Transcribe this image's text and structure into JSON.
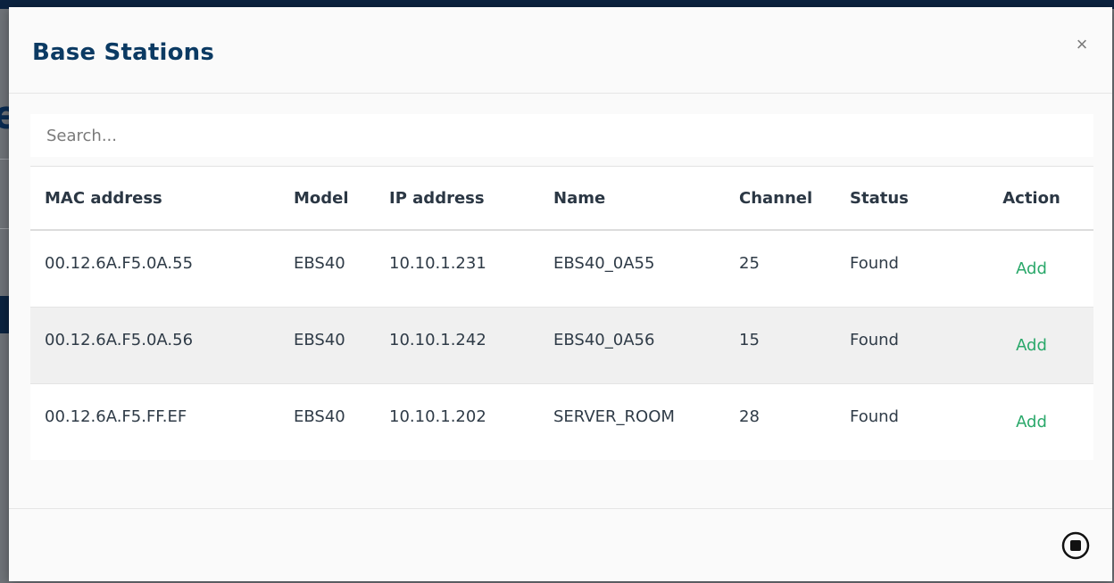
{
  "modal": {
    "title": "Base Stations",
    "close_label": "×"
  },
  "search": {
    "placeholder": "Search..."
  },
  "table": {
    "headers": [
      "MAC address",
      "Model",
      "IP address",
      "Name",
      "Channel",
      "Status",
      "Action"
    ],
    "rows": [
      {
        "mac": "00.12.6A.F5.0A.55",
        "model": "EBS40",
        "ip": "10.10.1.231",
        "name": "EBS40_0A55",
        "channel": "25",
        "status": "Found",
        "action": "Add"
      },
      {
        "mac": "00.12.6A.F5.0A.56",
        "model": "EBS40",
        "ip": "10.10.1.242",
        "name": "EBS40_0A56",
        "channel": "15",
        "status": "Found",
        "action": "Add"
      },
      {
        "mac": "00.12.6A.F5.FF.EF",
        "model": "EBS40",
        "ip": "10.10.1.202",
        "name": "SERVER_ROOM",
        "channel": "28",
        "status": "Found",
        "action": "Add"
      }
    ]
  },
  "footer": {
    "icon": "stop-circle-icon"
  },
  "colors": {
    "title": "#0b3a63",
    "action_link": "#2aa86a",
    "stripe": "#f0f0f0",
    "backdrop_bar": "#0c2340"
  }
}
